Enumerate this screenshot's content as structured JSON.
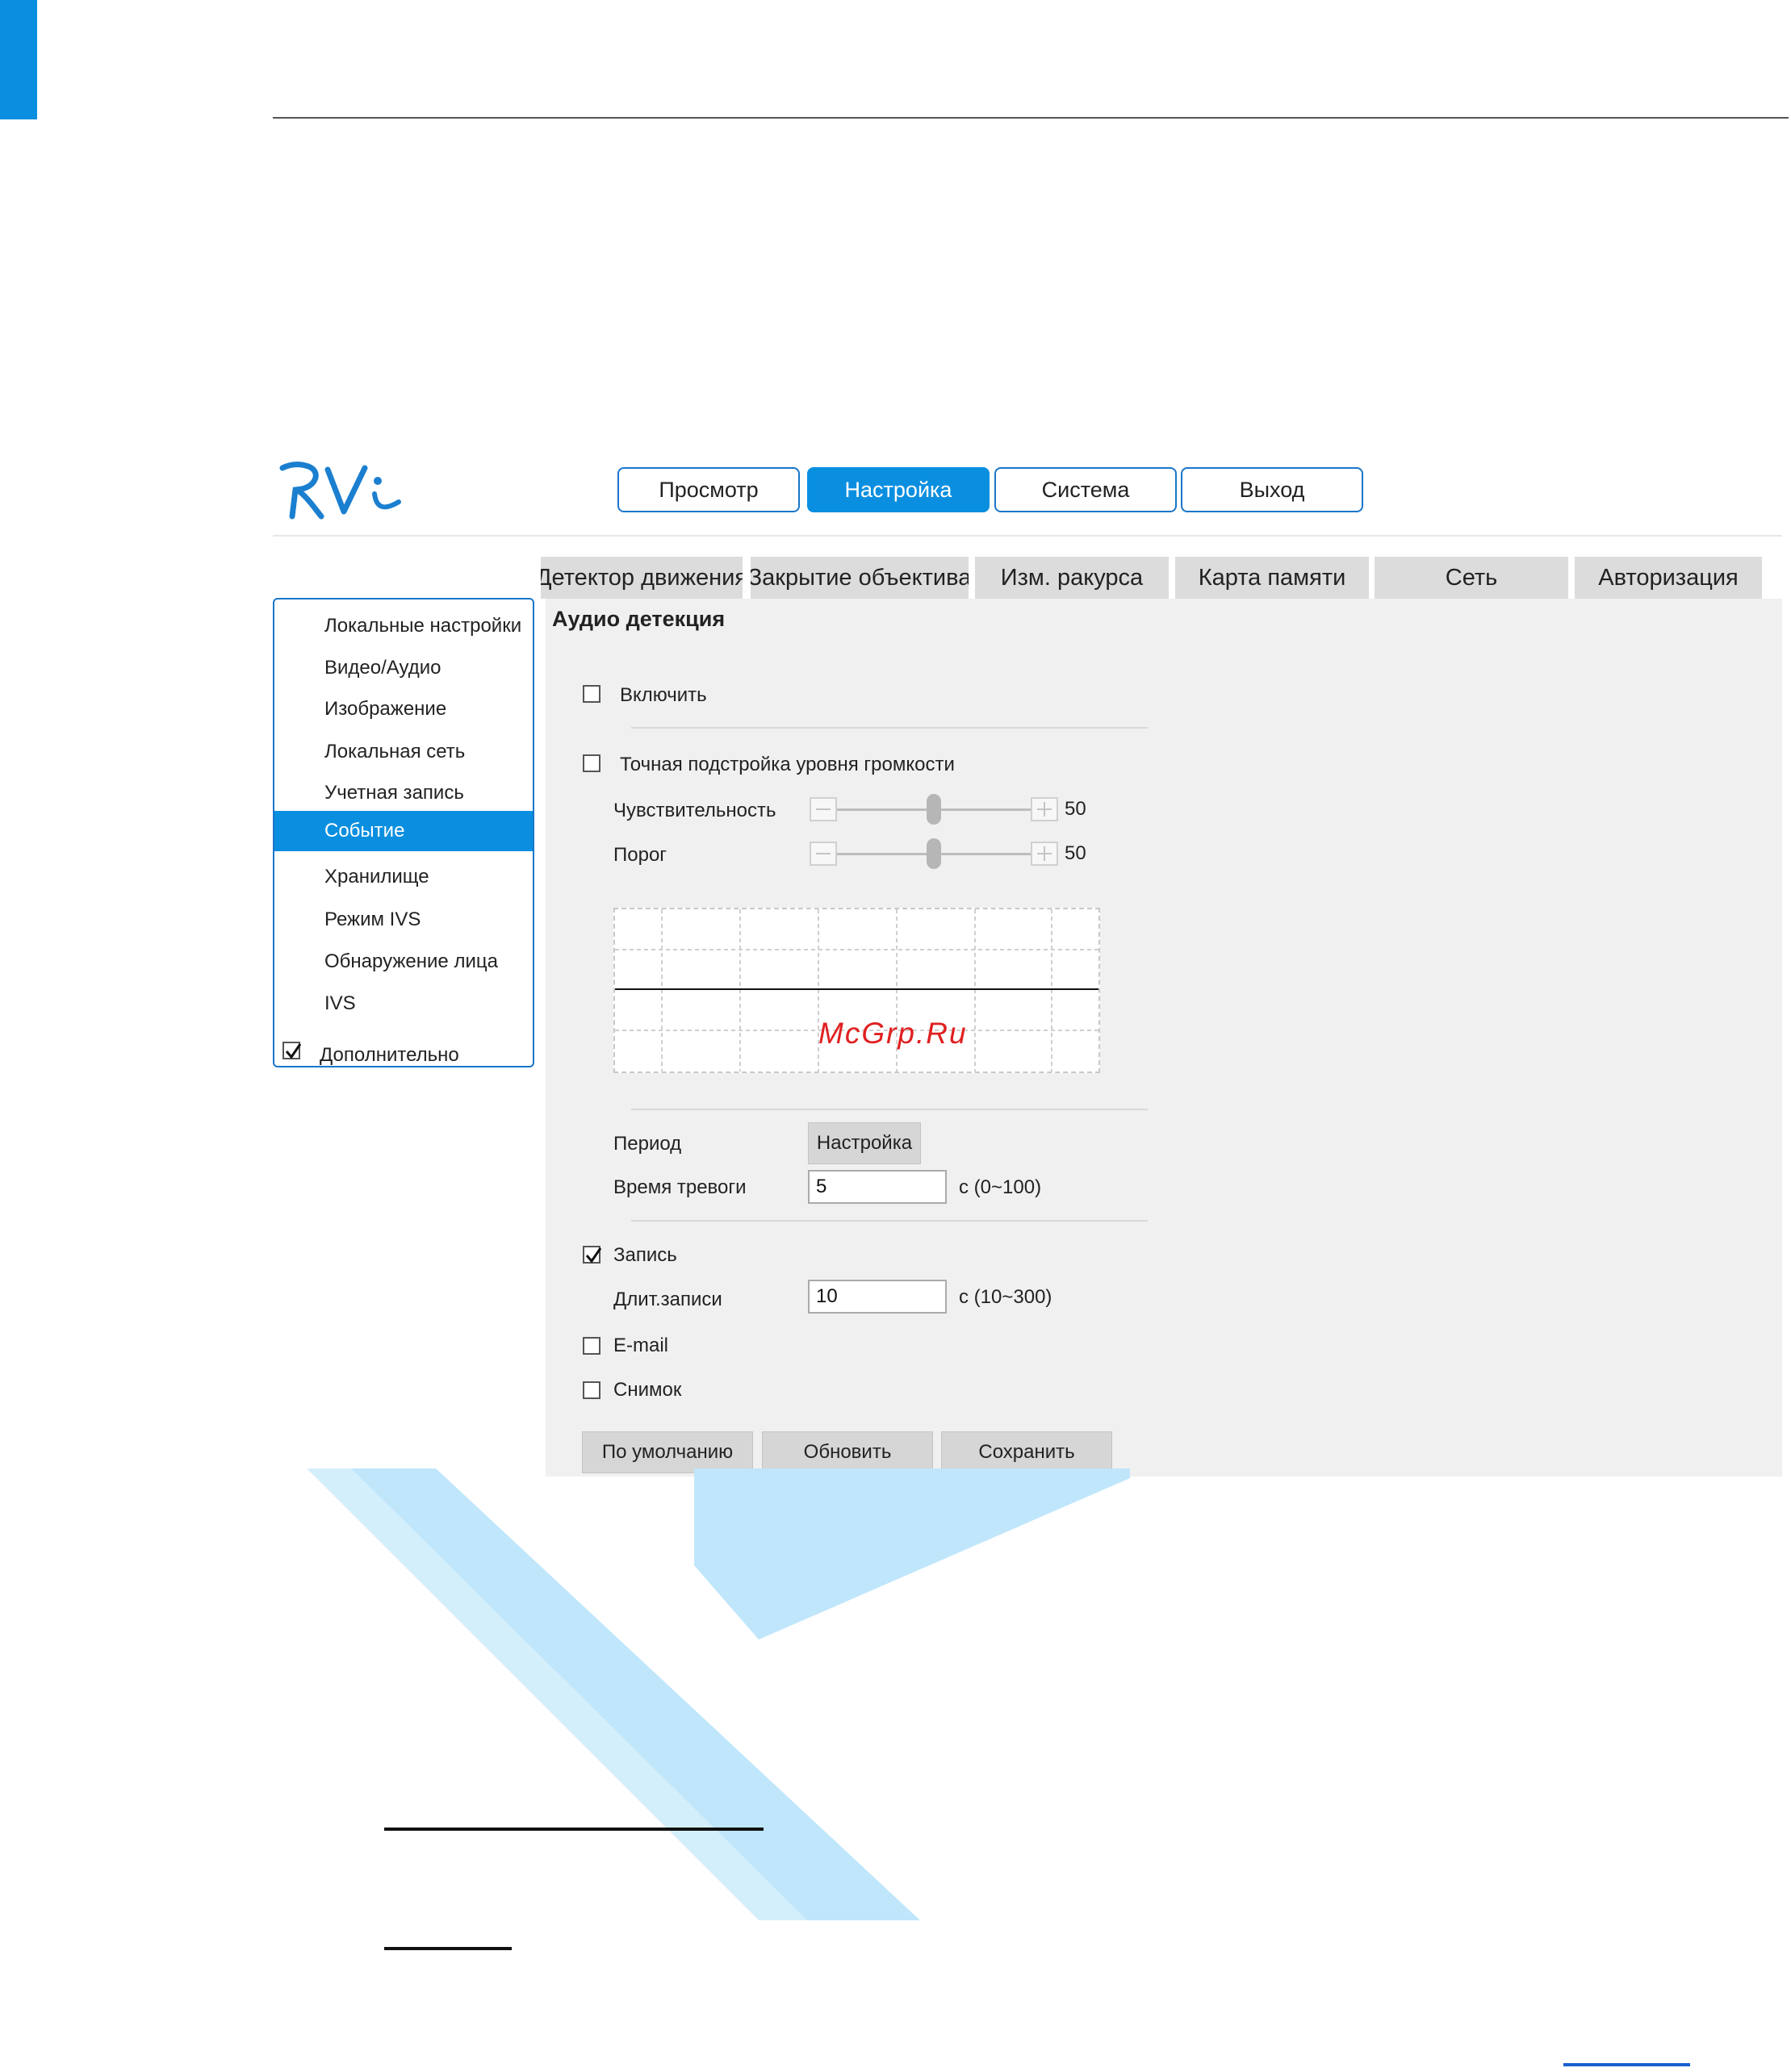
{
  "header": {
    "logo_text": "RVi",
    "nav": [
      {
        "label": "Просмотр",
        "active": false
      },
      {
        "label": "Настройка",
        "active": true
      },
      {
        "label": "Система",
        "active": false
      },
      {
        "label": "Выход",
        "active": false
      }
    ]
  },
  "tabs": [
    "Детектор движения",
    "Закрытие объектива",
    "Изм. ракурса",
    "Карта памяти",
    "Сеть",
    "Авторизация"
  ],
  "sidebar": {
    "items": [
      {
        "label": "Локальные настройки",
        "active": false
      },
      {
        "label": "Видео/Аудио",
        "active": false
      },
      {
        "label": "Изображение",
        "active": false
      },
      {
        "label": "Локальная сеть",
        "active": false
      },
      {
        "label": "Учетная запись",
        "active": false
      },
      {
        "label": "Событие",
        "active": true
      },
      {
        "label": "Хранилище",
        "active": false
      },
      {
        "label": "Режим IVS",
        "active": false
      },
      {
        "label": "Обнаружение лица",
        "active": false
      },
      {
        "label": "IVS",
        "active": false
      }
    ],
    "advanced": {
      "label": "Дополнительно",
      "checked": true
    }
  },
  "main": {
    "title": "Аудио детекция",
    "enable": {
      "label": "Включить",
      "checked": false
    },
    "fine_tune": {
      "label": "Точная подстройка уровня громкости",
      "checked": false
    },
    "sensitivity": {
      "label": "Чувствительность",
      "value": "50",
      "fraction": 0.5
    },
    "threshold": {
      "label": "Порог",
      "value": "50",
      "fraction": 0.5
    },
    "watermark": "McGrp.Ru",
    "period": {
      "label": "Период",
      "button": "Настройка"
    },
    "alarm_time": {
      "label": "Время тревоги",
      "value": "5",
      "hint": "с (0~100)"
    },
    "record": {
      "label": "Запись",
      "checked": true
    },
    "record_duration": {
      "label": "Длит.записи",
      "value": "10",
      "hint": "с (10~300)"
    },
    "email": {
      "label": "E-mail",
      "checked": false
    },
    "snapshot": {
      "label": "Снимок",
      "checked": false
    },
    "buttons": {
      "default": "По умолчанию",
      "refresh": "Обновить",
      "save": "Сохранить"
    }
  },
  "colors": {
    "accent": "#0a8fe0",
    "border_blue": "#1976c9",
    "watermark_red": "#e02020",
    "watermark_k": "#bfe6fb"
  }
}
